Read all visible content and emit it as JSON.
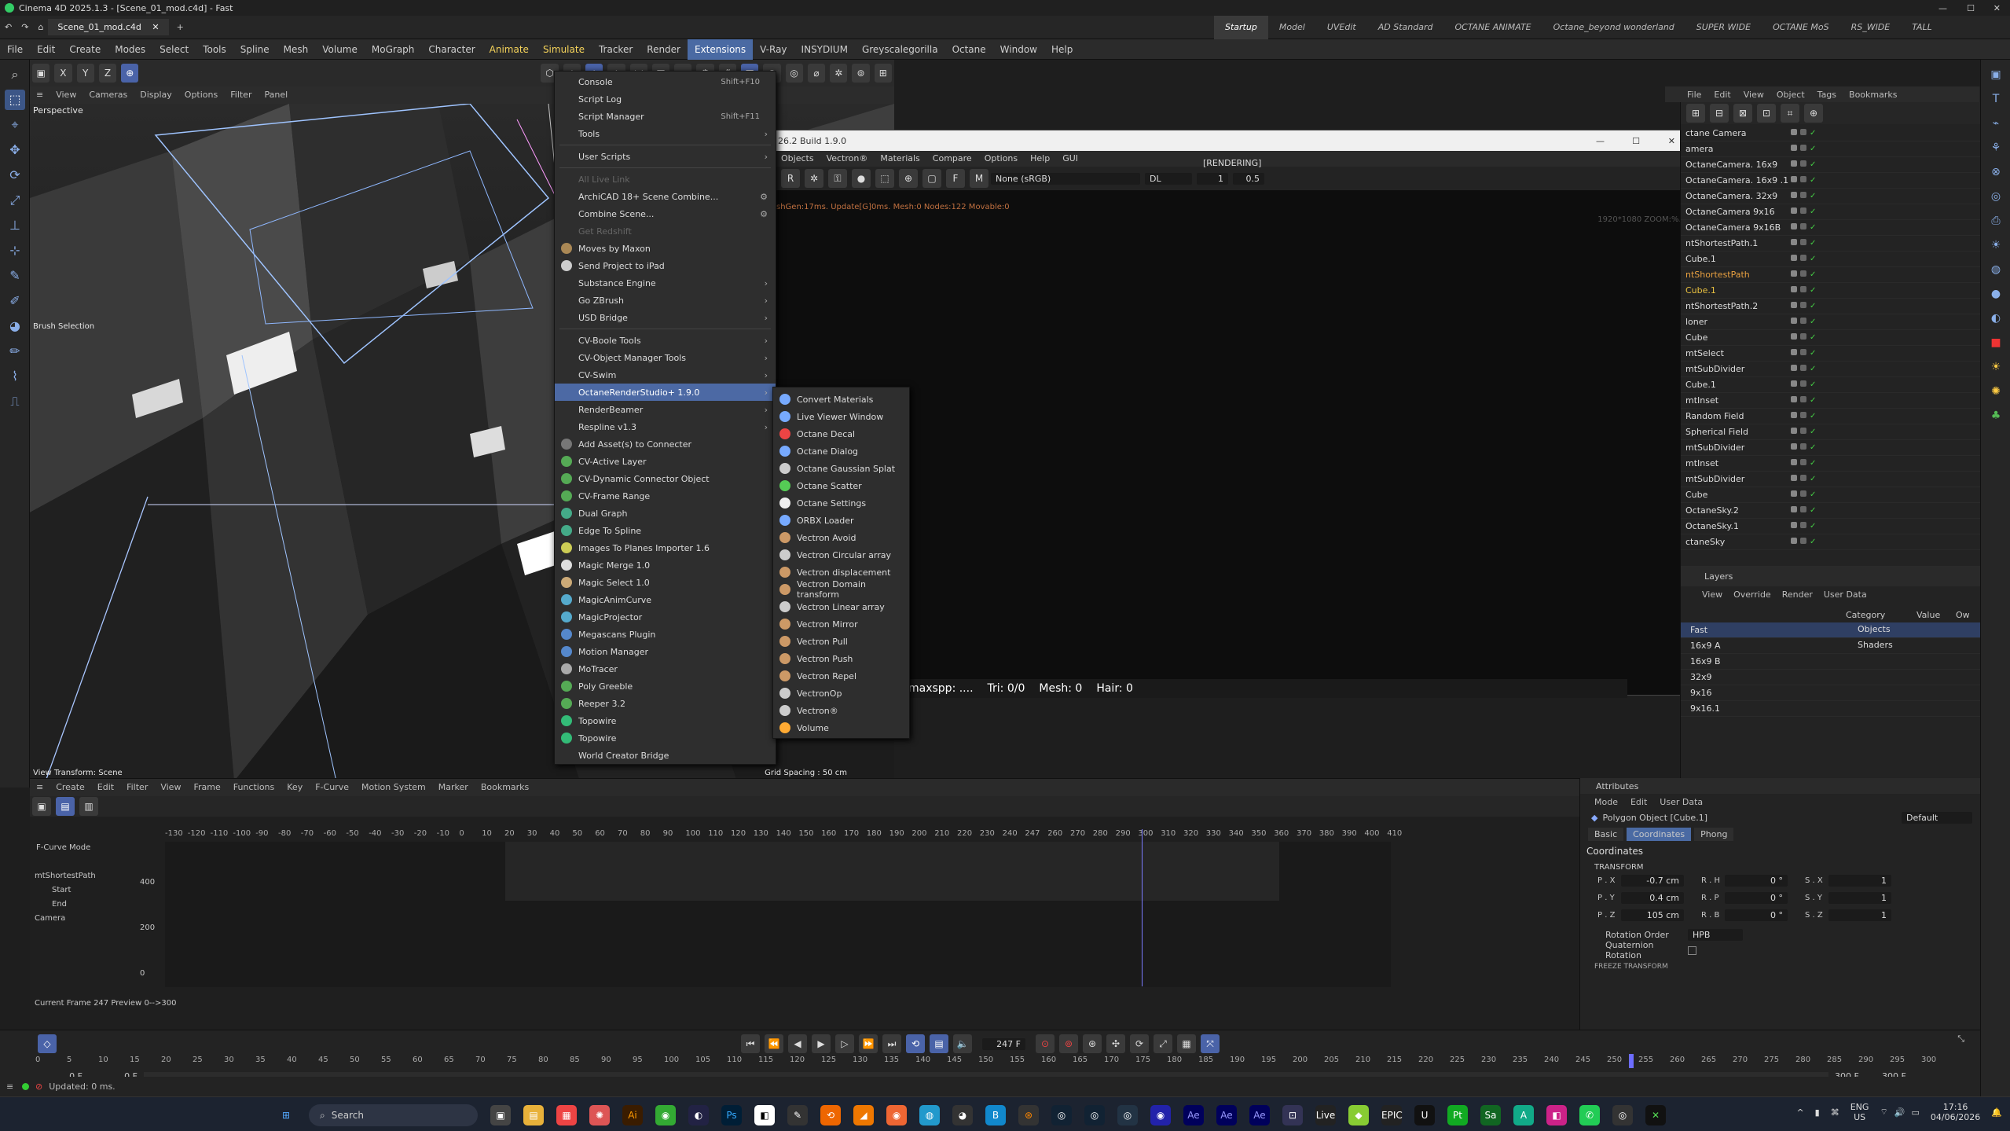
{
  "window": {
    "title": "Cinema 4D 2025.1.3 - [Scene_01_mod.c4d] - Fast",
    "doc_tab": "Scene_01_mod.c4d"
  },
  "layouts": [
    "Startup",
    "Model",
    "UVEdit",
    "AD Standard",
    "OCTANE ANIMATE",
    "Octane_beyond wonderland",
    "SUPER WIDE",
    "OCTANE MoS",
    "RS_WIDE",
    "TALL"
  ],
  "menubar": [
    "File",
    "Edit",
    "Create",
    "Modes",
    "Select",
    "Tools",
    "Spline",
    "Mesh",
    "Volume",
    "MoGraph",
    "Character",
    "Animate",
    "Simulate",
    "Tracker",
    "Render",
    "Extensions",
    "V-Ray",
    "INSYDIUM",
    "Greyscalegorilla",
    "Octane",
    "Window",
    "Help"
  ],
  "viewport": {
    "menu": [
      "View",
      "Cameras",
      "Display",
      "Options",
      "Filter",
      "Panel"
    ],
    "label": "Perspective",
    "brush": "Brush Selection",
    "transform": "View Transform: Scene",
    "grid": "Grid Spacing : 50 cm"
  },
  "axes": [
    "X",
    "Y",
    "Z"
  ],
  "ext_menu": [
    {
      "label": "Console",
      "shortcut": "Shift+F10"
    },
    {
      "label": "Script Log"
    },
    {
      "label": "Script Manager",
      "shortcut": "Shift+F11"
    },
    {
      "label": "Tools",
      "sub": true
    },
    {
      "sep": true
    },
    {
      "label": "User Scripts",
      "sub": true
    },
    {
      "sep": true
    },
    {
      "label": "All Live Link",
      "disabled": true
    },
    {
      "label": "ArchiCAD 18+ Scene Combine...",
      "gear": true
    },
    {
      "label": "Combine Scene...",
      "gear": true
    },
    {
      "label": "Get Redshift",
      "disabled": true
    },
    {
      "label": "Moves by Maxon",
      "icon": "#a85"
    },
    {
      "label": "Send Project to iPad",
      "icon": "#ccc"
    },
    {
      "label": "Substance Engine",
      "sub": true
    },
    {
      "label": "Go ZBrush",
      "sub": true
    },
    {
      "label": "USD Bridge",
      "sub": true
    },
    {
      "sep": true
    },
    {
      "label": "CV-Boole Tools",
      "sub": true
    },
    {
      "label": "CV-Object Manager Tools",
      "sub": true
    },
    {
      "label": "CV-Swim",
      "sub": true
    },
    {
      "label": "OctaneRenderStudio+ 1.9.0",
      "sub": true,
      "hover": true
    },
    {
      "label": "RenderBeamer",
      "sub": true
    },
    {
      "label": "Respline v1.3",
      "sub": true
    },
    {
      "label": "Add Asset(s) to Connecter",
      "icon": "#777"
    },
    {
      "label": "CV-Active Layer",
      "icon": "#5a5"
    },
    {
      "label": "CV-Dynamic Connector Object",
      "icon": "#5a5"
    },
    {
      "label": "CV-Frame Range",
      "icon": "#5a5"
    },
    {
      "label": "Dual Graph",
      "icon": "#4a8"
    },
    {
      "label": "Edge To Spline",
      "icon": "#4a8"
    },
    {
      "label": "Images To Planes Importer 1.6",
      "icon": "#cc5"
    },
    {
      "label": "Magic Merge 1.0",
      "icon": "#ddd"
    },
    {
      "label": "Magic Select 1.0",
      "icon": "#ca7"
    },
    {
      "label": "MagicAnimCurve",
      "icon": "#5ac"
    },
    {
      "label": "MagicProjector",
      "icon": "#5ac"
    },
    {
      "label": "Megascans Plugin",
      "icon": "#58c"
    },
    {
      "label": "Motion Manager",
      "icon": "#58c"
    },
    {
      "label": "MoTracer",
      "icon": "#aaa"
    },
    {
      "label": "Poly Greeble",
      "icon": "#5a5"
    },
    {
      "label": "Reeper 3.2",
      "icon": "#5a5"
    },
    {
      "label": "Topowire",
      "icon": "#3b7"
    },
    {
      "label": "Topowire",
      "icon": "#3b7"
    },
    {
      "label": "World Creator Bridge"
    }
  ],
  "octane_submenu": [
    "Convert Materials",
    "Live Viewer Window",
    "Octane Decal",
    "Octane Dialog",
    "Octane Gaussian Splat",
    "Octane Scatter",
    "Octane Settings",
    "ORBX Loader",
    "Vectron Avoid",
    "Vectron Circular array",
    "Vectron displacement",
    "Vectron Domain transform",
    "Vectron Linear array",
    "Vectron Mirror",
    "Vectron Pull",
    "Vectron Push",
    "Vectron Repel",
    "VectronOp",
    "Vectron®",
    "Volume"
  ],
  "octane_window": {
    "title": "26.2 Build 1.9.0",
    "menu": [
      "Objects",
      "Vectron®",
      "Materials",
      "Compare",
      "Options",
      "Help",
      "GUI"
    ],
    "status": "[RENDERING]",
    "colorspace": "None (sRGB)",
    "kernel": "DL",
    "v1": "1",
    "v2": "0.5",
    "log": "shGen:17ms. Update[G]0ms. Mesh:0 Nodes:122 Movable:0",
    "res": "1920*1080 ZOOM:%.0",
    "stats": {
      "maxspp": "maxspp: ....",
      "tri": "Tri: 0/0",
      "mesh": "Mesh: 0",
      "hair": "Hair: 0"
    }
  },
  "objects_menu": [
    "File",
    "Edit",
    "View",
    "Object",
    "Tags",
    "Bookmarks"
  ],
  "objects": [
    {
      "name": "ctane Camera"
    },
    {
      "name": "amera"
    },
    {
      "name": "OctaneCamera. 16x9"
    },
    {
      "name": "OctaneCamera. 16x9 .1"
    },
    {
      "name": "OctaneCamera. 32x9"
    },
    {
      "name": "OctaneCamera 9x16"
    },
    {
      "name": "OctaneCamera 9x16B"
    },
    {
      "name": "ntShortestPath.1"
    },
    {
      "name": "Cube.1"
    },
    {
      "name": "ntShortestPath",
      "color": "#e8a040"
    },
    {
      "name": "Cube.1",
      "color": "#e8c040"
    },
    {
      "name": "ntShortestPath.2"
    },
    {
      "name": "loner"
    },
    {
      "name": "Cube"
    },
    {
      "name": "mtSelect"
    },
    {
      "name": "mtSubDivider"
    },
    {
      "name": "Cube.1"
    },
    {
      "name": "mtInset"
    },
    {
      "name": "Random Field"
    },
    {
      "name": "Spherical Field"
    },
    {
      "name": "mtSubDivider"
    },
    {
      "name": "mtInset"
    },
    {
      "name": "mtSubDivider"
    },
    {
      "name": "Cube"
    },
    {
      "name": "OctaneSky.2"
    },
    {
      "name": "OctaneSky.1"
    },
    {
      "name": "ctaneSky"
    }
  ],
  "layers": {
    "tab": "Layers",
    "menu": [
      "View",
      "Override",
      "Render",
      "User Data"
    ],
    "rows": [
      "Fast",
      "16x9 A",
      "16x9 B",
      "32x9",
      "9x16",
      "9x16.1"
    ],
    "cols": [
      "Category",
      "Value",
      "Ow"
    ],
    "categories": [
      "Objects",
      "Shaders"
    ]
  },
  "timeline": {
    "menu": [
      "Create",
      "Edit",
      "Filter",
      "View",
      "Frame",
      "Functions",
      "Key",
      "F-Curve",
      "Motion System",
      "Marker",
      "Bookmarks"
    ],
    "mode": "F-Curve Mode",
    "tracks": [
      "mtShortestPath",
      "Start",
      "End",
      "Camera"
    ],
    "yvals": [
      "400",
      "200",
      "0"
    ],
    "ruler": [
      "-130",
      "-120",
      "-110",
      "-100",
      "-90",
      "-80",
      "-70",
      "-60",
      "-50",
      "-40",
      "-30",
      "-20",
      "-10",
      "0",
      "10",
      "20",
      "30",
      "40",
      "50",
      "60",
      "70",
      "80",
      "90",
      "100",
      "110",
      "120",
      "130",
      "140",
      "150",
      "160",
      "170",
      "180",
      "190",
      "200",
      "210",
      "220",
      "230",
      "240",
      "247",
      "260",
      "270",
      "280",
      "290",
      "300",
      "310",
      "320",
      "330",
      "340",
      "350",
      "360",
      "370",
      "380",
      "390",
      "400",
      "410"
    ],
    "current": "Current Frame  247  Preview  0-->300"
  },
  "attributes": {
    "tab": "Attributes",
    "menu": [
      "Mode",
      "Edit",
      "User Data"
    ],
    "object": "Polygon Object [Cube.1]",
    "preset": "Default",
    "tabs": [
      "Basic",
      "Coordinates",
      "Phong"
    ],
    "section": "Coordinates",
    "transform": "TRANSFORM",
    "pos": [
      {
        "l": "P . X",
        "v": "-0.7 cm"
      },
      {
        "l": "P . Y",
        "v": "0.4 cm"
      },
      {
        "l": "P . Z",
        "v": "105 cm"
      }
    ],
    "rot": [
      {
        "l": "R . H",
        "v": "0 °"
      },
      {
        "l": "R . P",
        "v": "0 °"
      },
      {
        "l": "R . B",
        "v": "0 °"
      }
    ],
    "scl": [
      {
        "l": "S . X",
        "v": "1"
      },
      {
        "l": "S . Y",
        "v": "1"
      },
      {
        "l": "S . Z",
        "v": "1"
      }
    ],
    "rotorder_label": "Rotation Order",
    "rotorder": "HPB",
    "quat": "Quaternion Rotation",
    "freeze": "FREEZE TRANSFORM"
  },
  "transport": {
    "frame": "247 F",
    "start": "0 F",
    "start2": "0 F",
    "end": "300 F",
    "end2": "300 F"
  },
  "ruler2": [
    "0",
    "5",
    "10",
    "15",
    "20",
    "25",
    "30",
    "35",
    "40",
    "45",
    "50",
    "55",
    "60",
    "65",
    "70",
    "75",
    "80",
    "85",
    "90",
    "95",
    "100",
    "105",
    "110",
    "115",
    "120",
    "125",
    "130",
    "135",
    "140",
    "145",
    "150",
    "155",
    "160",
    "165",
    "170",
    "175",
    "180",
    "185",
    "190",
    "195",
    "200",
    "205",
    "210",
    "215",
    "220",
    "225",
    "230",
    "235",
    "240",
    "245",
    "250",
    "255",
    "260",
    "265",
    "270",
    "275",
    "280",
    "285",
    "290",
    "295",
    "300"
  ],
  "status": "Updated: 0 ms.",
  "taskbar": {
    "search": "Search",
    "lang": "ENG",
    "region": "US",
    "time": "17:16",
    "date": "04/06/2026"
  },
  "colors": {
    "accent": "#4a6aa3",
    "menuHover": "#4c69a4"
  }
}
